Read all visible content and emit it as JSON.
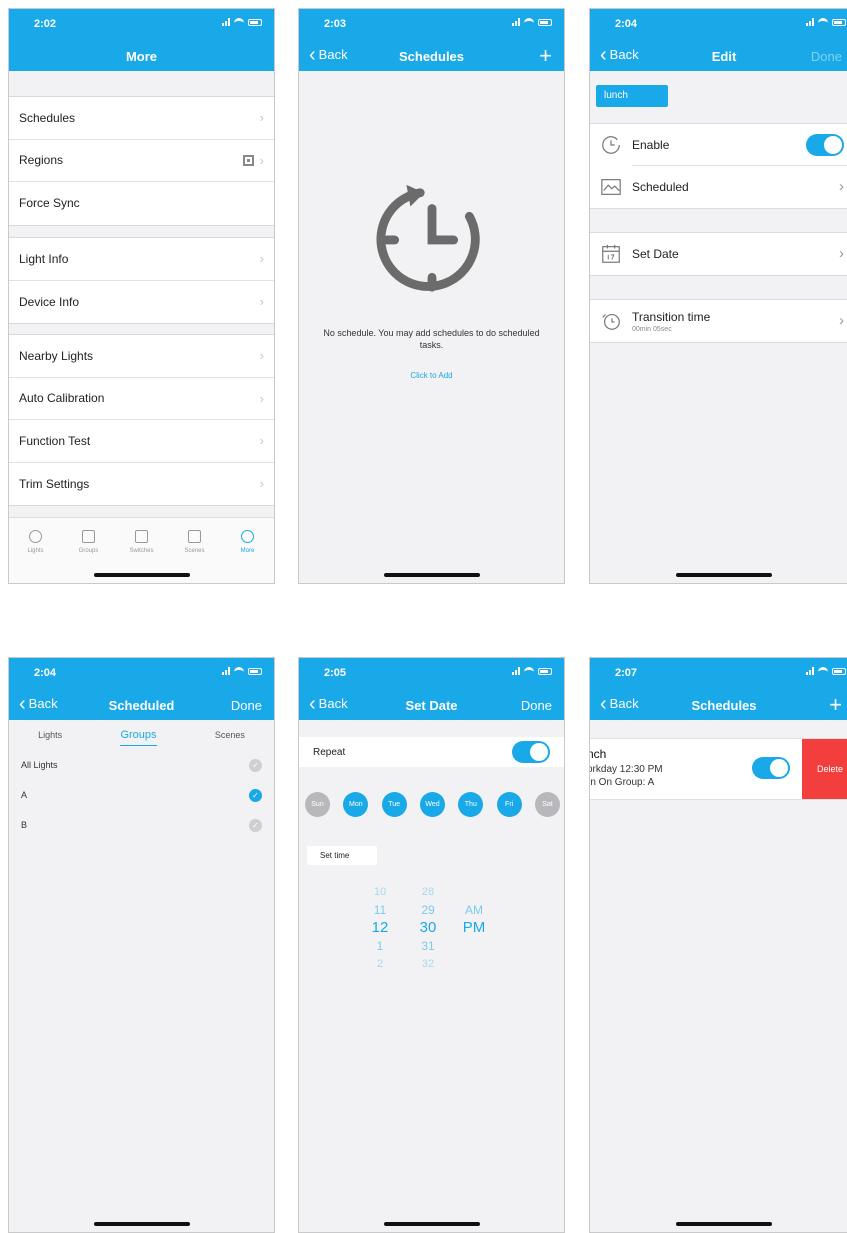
{
  "screens": {
    "more": {
      "time": "2:02",
      "title": "More",
      "group1": [
        "Schedules",
        "Regions",
        "Force Sync"
      ],
      "group2": [
        "Light Info",
        "Device Info"
      ],
      "group3": [
        "Nearby Lights",
        "Auto Calibration",
        "Function Test",
        "Trim Settings"
      ],
      "tabs": [
        "Lights",
        "Groups",
        "Switches",
        "Scenes",
        "More"
      ],
      "active_tab": "More"
    },
    "schedules_empty": {
      "time": "2:03",
      "back": "Back",
      "title": "Schedules",
      "empty_text": "No schedule. You may add schedules to do scheduled tasks.",
      "click_to_add": "Click to Add"
    },
    "edit": {
      "time": "2:04",
      "back": "Back",
      "title": "Edit",
      "done": "Done",
      "name": "lunch",
      "enable_label": "Enable",
      "enable_on": true,
      "scheduled_label": "Scheduled",
      "set_date_label": "Set Date",
      "transition_label": "Transition time",
      "transition_value": "00min 05sec"
    },
    "scheduled": {
      "time": "2:04",
      "back": "Back",
      "title": "Scheduled",
      "done": "Done",
      "segments": [
        "Lights",
        "Groups",
        "Scenes"
      ],
      "active_segment": "Groups",
      "rows": [
        {
          "label": "All Lights",
          "checked": false
        },
        {
          "label": "A",
          "checked": true
        },
        {
          "label": "B",
          "checked": false
        }
      ]
    },
    "set_date": {
      "time": "2:05",
      "back": "Back",
      "title": "Set Date",
      "done": "Done",
      "repeat_label": "Repeat",
      "repeat_on": true,
      "days": [
        {
          "label": "Sun",
          "on": false
        },
        {
          "label": "Mon",
          "on": true
        },
        {
          "label": "Tue",
          "on": true
        },
        {
          "label": "Wed",
          "on": true
        },
        {
          "label": "Thu",
          "on": true
        },
        {
          "label": "Fri",
          "on": true
        },
        {
          "label": "Sat",
          "on": false
        }
      ],
      "set_time_label": "Set time",
      "hours": [
        "10",
        "11",
        "12",
        "1",
        "2"
      ],
      "minutes": [
        "28",
        "29",
        "30",
        "31",
        "32"
      ],
      "ampm": [
        "AM",
        "PM"
      ],
      "selected": {
        "hour": "12",
        "minute": "30",
        "ampm": "PM"
      }
    },
    "schedules_list": {
      "time": "2:07",
      "back": "Back",
      "title": "Schedules",
      "item_name": "nch",
      "item_line1": "orkday 12:30 PM",
      "item_line2": "rn On Group: A",
      "item_enabled": true,
      "delete_label": "Delete"
    }
  },
  "colors": {
    "accent": "#1aa9e8",
    "delete": "#f33e3e",
    "background": "#f2f2f4"
  }
}
